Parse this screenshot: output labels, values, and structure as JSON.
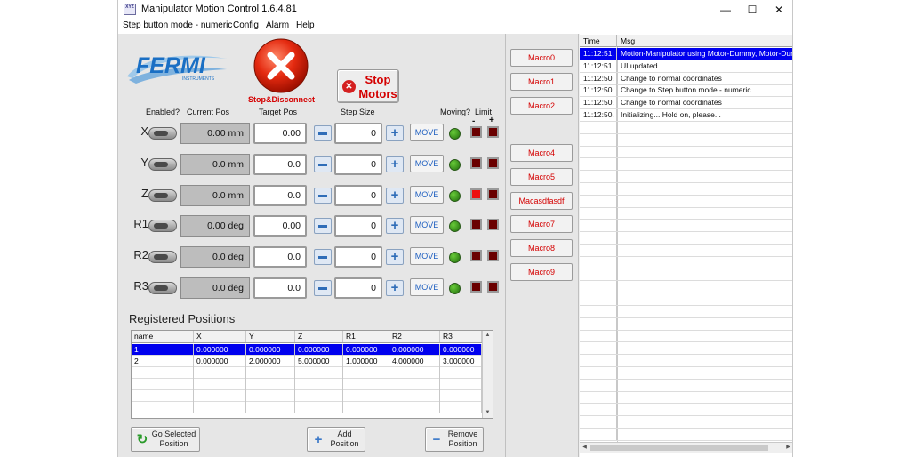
{
  "window": {
    "title": "Manipulator Motion Control 1.6.4.81",
    "icon_text": "XYZ",
    "minimize": "—",
    "maximize": "☐",
    "close": "✕"
  },
  "menu": [
    "Step button mode - numeric",
    "Config",
    "Alarm",
    "Help"
  ],
  "logo": {
    "text": "FERMI",
    "subtext": "INSTRUMENTS"
  },
  "buttons": {
    "stop_disconnect": "Stop&Disconnect",
    "stop_motors_line1": "Stop",
    "stop_motors_line2": "Motors",
    "move": "MOVE",
    "go_selected_line1": "Go Selected",
    "go_selected_line2": "Position",
    "add_line1": "Add",
    "add_line2": "Position",
    "remove_line1": "Remove",
    "remove_line2": "Position"
  },
  "headers": {
    "enabled": "Enabled?",
    "current_pos": "Current Pos",
    "target_pos": "Target Pos",
    "step_size": "Step Size",
    "moving": "Moving?",
    "limit": "Limit",
    "limit_minus": "-",
    "limit_plus": "+"
  },
  "axes": [
    {
      "name": "X",
      "current": "0.00 mm",
      "target": "0.00",
      "step": "0",
      "limit_minus_on": false,
      "limit_plus_on": false
    },
    {
      "name": "Y",
      "current": "0.0 mm",
      "target": "0.0",
      "step": "0",
      "limit_minus_on": false,
      "limit_plus_on": false
    },
    {
      "name": "Z",
      "current": "0.0 mm",
      "target": "0.0",
      "step": "0",
      "limit_minus_on": true,
      "limit_plus_on": false
    },
    {
      "name": "R1",
      "current": "0.00 deg",
      "target": "0.00",
      "step": "0",
      "limit_minus_on": false,
      "limit_plus_on": false
    },
    {
      "name": "R2",
      "current": "0.0 deg",
      "target": "0.0",
      "step": "0",
      "limit_minus_on": false,
      "limit_plus_on": false
    },
    {
      "name": "R3",
      "current": "0.0 deg",
      "target": "0.0",
      "step": "0",
      "limit_minus_on": false,
      "limit_plus_on": false
    }
  ],
  "registered": {
    "title": "Registered Positions",
    "columns": [
      "name",
      "X",
      "Y",
      "Z",
      "R1",
      "R2",
      "R3"
    ],
    "rows": [
      [
        "1",
        "0.000000",
        "0.000000",
        "0.000000",
        "0.000000",
        "0.000000",
        "0.000000"
      ],
      [
        "2",
        "0.000000",
        "2.000000",
        "5.000000",
        "1.000000",
        "4.000000",
        "3.000000"
      ]
    ],
    "selected_row": 0
  },
  "macros": [
    {
      "label": "Macro0",
      "group": 1
    },
    {
      "label": "Macro1",
      "group": 1
    },
    {
      "label": "Macro2",
      "group": 1
    },
    {
      "label": "Macro4",
      "group": 2
    },
    {
      "label": "Macro5",
      "group": 2
    },
    {
      "label": "Macasdfasdf",
      "group": 2
    },
    {
      "label": "Macro7",
      "group": 2
    },
    {
      "label": "Macro8",
      "group": 2
    },
    {
      "label": "Macro9",
      "group": 2
    }
  ],
  "log": {
    "columns": [
      "Time",
      "Msg"
    ],
    "rows": [
      [
        "11:12:51.",
        "Motion-Manipulator using Motor-Dummy, Motor-Dummy"
      ],
      [
        "11:12:51.",
        "UI updated"
      ],
      [
        "11:12:50.",
        "Change to normal coordinates"
      ],
      [
        "11:12:50.",
        "Change to Step button mode - numeric"
      ],
      [
        "11:12:50.",
        "Change to normal coordinates"
      ],
      [
        "11:12:50.",
        "Initializing... Hold on, please..."
      ]
    ],
    "selected_row": 0
  },
  "colors": {
    "selection": "#0000ee",
    "alert_red": "#d40000",
    "led_green": "#3a9a1a",
    "logo_blue": "#1a6fc4"
  }
}
